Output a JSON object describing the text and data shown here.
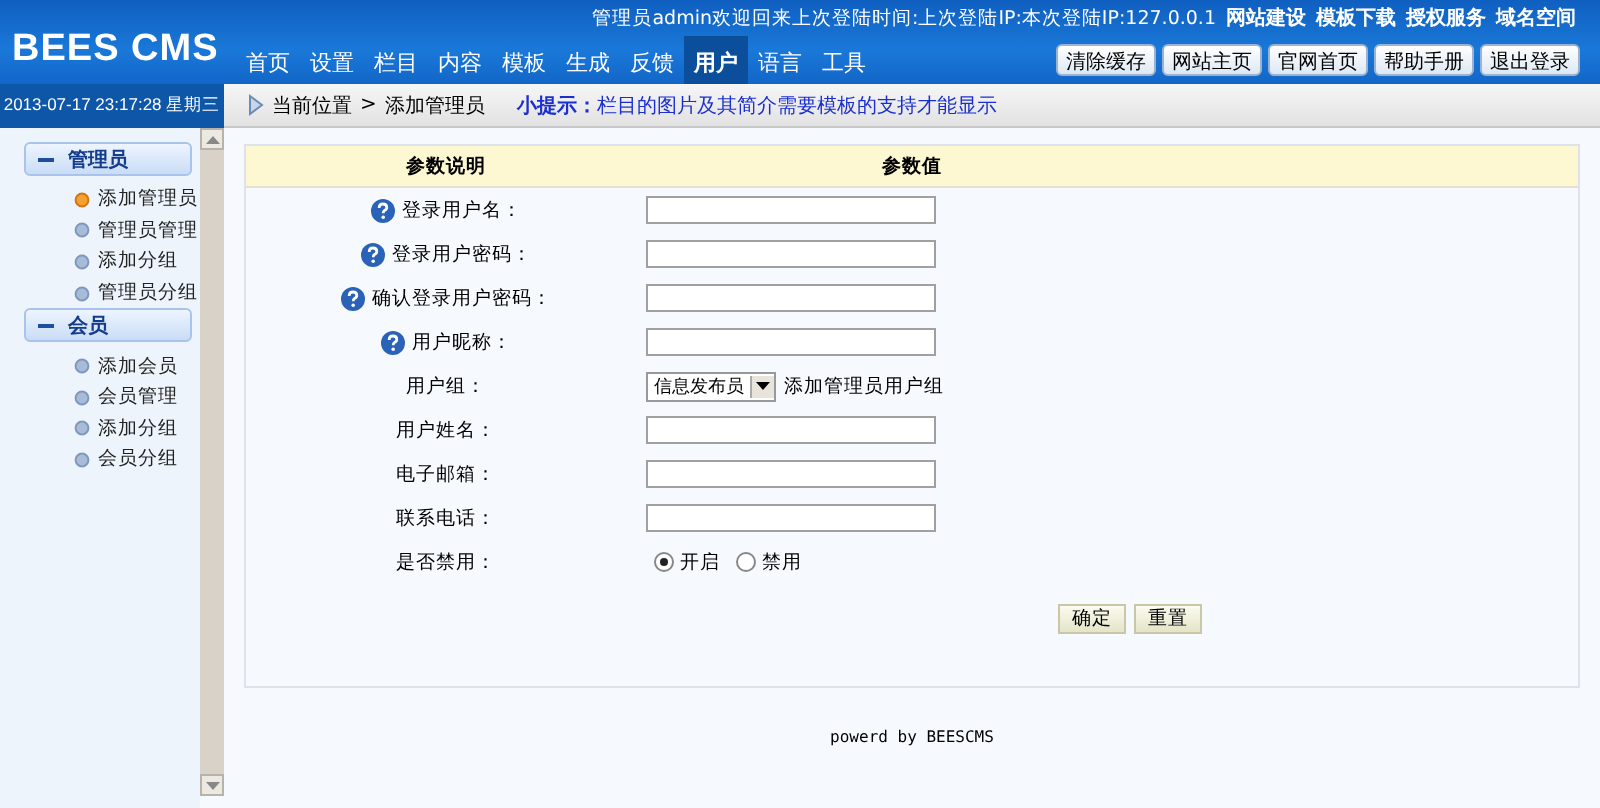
{
  "header": {
    "logo": "BEES CMS",
    "top_line": "管理员admin欢迎回来上次登陆时间:上次登陆IP:本次登陆IP:127.0.0.1",
    "top_links": [
      "网站建设",
      "模板下载",
      "授权服务",
      "域名空间"
    ],
    "nav": [
      {
        "label": "首页",
        "selected": false
      },
      {
        "label": "设置",
        "selected": false
      },
      {
        "label": "栏目",
        "selected": false
      },
      {
        "label": "内容",
        "selected": false
      },
      {
        "label": "模板",
        "selected": false
      },
      {
        "label": "生成",
        "selected": false
      },
      {
        "label": "反馈",
        "selected": false
      },
      {
        "label": "用户",
        "selected": true
      },
      {
        "label": "语言",
        "selected": false
      },
      {
        "label": "工具",
        "selected": false
      }
    ],
    "buttons": [
      "清除缓存",
      "网站主页",
      "官网首页",
      "帮助手册",
      "退出登录"
    ]
  },
  "datetime": "2013-07-17 23:17:28 星期三",
  "breadcrumb": {
    "location": "当前位置",
    "separator": ">",
    "page": "添加管理员",
    "tip_label": "小提示：",
    "tip": "栏目的图片及其简介需要模板的支持才能显示"
  },
  "sidebar": [
    {
      "title": "管理员",
      "expanded": true,
      "items": [
        {
          "label": "添加管理员",
          "selected": true
        },
        {
          "label": "管理员管理",
          "selected": false
        },
        {
          "label": "添加分组",
          "selected": false
        },
        {
          "label": "管理员分组",
          "selected": false
        }
      ]
    },
    {
      "title": "会员",
      "expanded": true,
      "items": [
        {
          "label": "添加会员",
          "selected": false
        },
        {
          "label": "会员管理",
          "selected": false
        },
        {
          "label": "添加分组",
          "selected": false
        },
        {
          "label": "会员分组",
          "selected": false
        }
      ]
    }
  ],
  "form": {
    "columns": [
      "参数说明",
      "参数值"
    ],
    "rows": [
      {
        "kind": "input",
        "label": "登录用户名：",
        "help": true
      },
      {
        "kind": "input",
        "label": "登录用户密码：",
        "help": true
      },
      {
        "kind": "input",
        "label": "确认登录用户密码：",
        "help": true
      },
      {
        "kind": "input",
        "label": "用户昵称：",
        "help": true
      },
      {
        "kind": "select",
        "label": "用户组：",
        "help": false,
        "value": "信息发布员",
        "note": "添加管理员用户组"
      },
      {
        "kind": "input",
        "label": "用户姓名：",
        "help": false
      },
      {
        "kind": "input",
        "label": "电子邮箱：",
        "help": false
      },
      {
        "kind": "input",
        "label": "联系电话：",
        "help": false
      },
      {
        "kind": "radio",
        "label": "是否禁用：",
        "help": false,
        "options": [
          {
            "label": "开启",
            "selected": true
          },
          {
            "label": "禁用",
            "selected": false
          }
        ]
      }
    ],
    "buttons": [
      "确定",
      "重置"
    ]
  },
  "footer": "powerd by BEESCMS"
}
